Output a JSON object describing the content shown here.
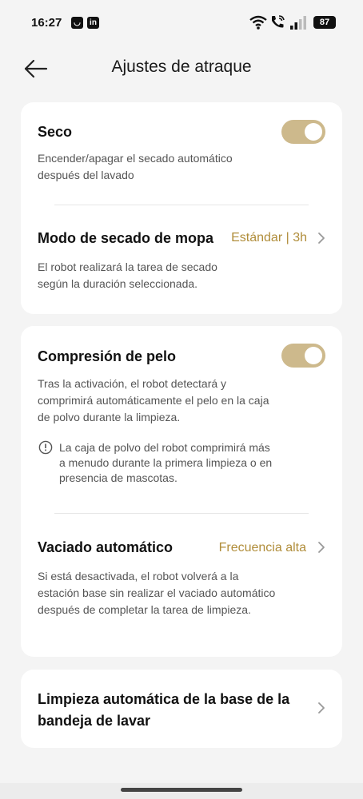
{
  "status_bar": {
    "time": "16:27",
    "app_icons": [
      "messenger-icon",
      "linkedin-icon"
    ],
    "battery": "87"
  },
  "header": {
    "title": "Ajustes de atraque"
  },
  "card1": {
    "dry": {
      "title": "Seco",
      "description": "Encender/apagar el secado automático después del lavado",
      "enabled": true
    },
    "mop_dry_mode": {
      "title": "Modo de secado de mopa",
      "value": "Estándar | 3h",
      "description": "El robot realizará la tarea de secado según la duración seleccionada."
    }
  },
  "card2": {
    "hair_compression": {
      "title": "Compresión de pelo",
      "description": "Tras la activación, el robot detectará y comprimirá automáticamente el pelo en la caja de polvo durante la limpieza.",
      "enabled": true,
      "note": "La caja de polvo del robot comprimirá más a menudo durante la primera limpieza o en presencia de mascotas."
    },
    "auto_empty": {
      "title": "Vaciado automático",
      "value": "Frecuencia alta",
      "description": "Si está desactivada, el robot volverá a la estación base sin realizar el vaciado automático después de completar la tarea de limpieza."
    }
  },
  "card3": {
    "auto_clean_tray": {
      "title": "Limpieza automática de la base de la bandeja de lavar"
    }
  },
  "colors": {
    "accent": "#b08d3a",
    "toggle_on": "#cdb98c",
    "background": "#f4f4f4",
    "card": "#ffffff"
  }
}
